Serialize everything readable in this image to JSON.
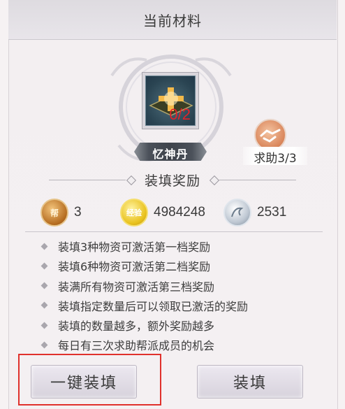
{
  "header": {
    "title": "当前材料"
  },
  "item": {
    "name": "忆神丹",
    "count": "0/2"
  },
  "help": {
    "label": "求助3/3"
  },
  "section": {
    "title": "装填奖励"
  },
  "rewards": [
    {
      "icon": "guild-badge-icon",
      "icon_text": "帮",
      "value": "3"
    },
    {
      "icon": "experience-coin-icon",
      "icon_text": "经验",
      "value": "4984248"
    },
    {
      "icon": "silver-dragon-coin-icon",
      "icon_text": "",
      "value": "2531"
    }
  ],
  "rules": [
    "装填3种物资可激活第一档奖励",
    "装填6种物资可激活第二档奖励",
    "装满所有物资可激活第三档奖励",
    "装填指定数量后可以领取已激活的奖励",
    "装填的数量越多，额外奖励越多",
    "每日有三次求助帮派成员的机会"
  ],
  "buttons": {
    "auto_fill": "一键装填",
    "fill": "装填"
  },
  "colors": {
    "count": "#e0242a",
    "highlight": "#e0312c"
  }
}
